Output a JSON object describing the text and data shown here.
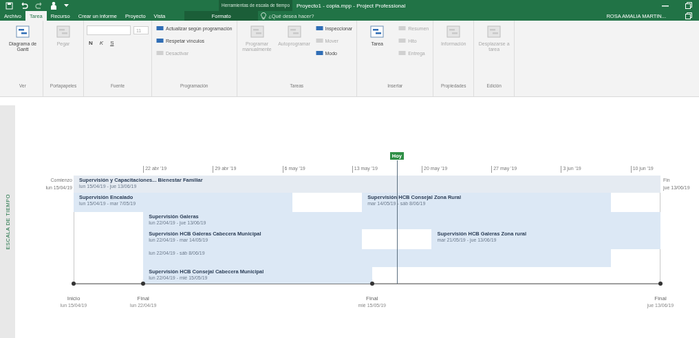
{
  "window": {
    "contextual_title": "Herramientas de escala de tiempo",
    "title": "Proyecto1 - copia.mpp - Project Professional"
  },
  "tabs": [
    {
      "label": "Archivo",
      "selected": false
    },
    {
      "label": "Tarea",
      "selected": true
    },
    {
      "label": "Recurso",
      "selected": false
    },
    {
      "label": "Crear un informe",
      "selected": false
    },
    {
      "label": "Proyecto",
      "selected": false
    },
    {
      "label": "Vista",
      "selected": false
    }
  ],
  "contextual_tab": {
    "label": "Formato",
    "selected": false
  },
  "search": {
    "placeholder": "¿Qué desea hacer?"
  },
  "user": "ROSA AMALIA MARTIN...",
  "ribbon": [
    {
      "label": "Ver",
      "items": [
        {
          "kind": "large",
          "label": "Diagrama de Gantt",
          "disabled": false
        }
      ]
    },
    {
      "label": "Portapapeles",
      "items": [
        {
          "kind": "large",
          "label": "Pegar",
          "disabled": true
        }
      ]
    },
    {
      "label": "Fuente",
      "items": [
        {
          "kind": "font",
          "size": "11",
          "styles": [
            "N",
            "K",
            "S"
          ],
          "disabled": true
        }
      ]
    },
    {
      "label": "Programación",
      "items": [
        {
          "kind": "small",
          "label": "Actualizar según programación",
          "disabled": false
        },
        {
          "kind": "small",
          "label": "Respetar vínculos",
          "disabled": false
        },
        {
          "kind": "small",
          "label": "Desactivar",
          "disabled": true
        }
      ]
    },
    {
      "label": "Tareas",
      "items": [
        {
          "kind": "large",
          "label": "Programar manualmente",
          "disabled": true
        },
        {
          "kind": "large",
          "label": "Autoprogramar",
          "disabled": true
        },
        {
          "kind": "small",
          "label": "Inspeccionar",
          "disabled": false
        },
        {
          "kind": "small",
          "label": "Mover",
          "disabled": true
        },
        {
          "kind": "small",
          "label": "Modo",
          "disabled": false
        }
      ]
    },
    {
      "label": "Insertar",
      "items": [
        {
          "kind": "large",
          "label": "Tarea",
          "disabled": false
        },
        {
          "kind": "small",
          "label": "Resumen",
          "disabled": true
        },
        {
          "kind": "small",
          "label": "Hito",
          "disabled": true
        },
        {
          "kind": "small",
          "label": "Entrega",
          "disabled": true
        }
      ]
    },
    {
      "label": "Propiedades",
      "items": [
        {
          "kind": "large",
          "label": "Información",
          "disabled": true
        }
      ]
    },
    {
      "label": "Edición",
      "items": [
        {
          "kind": "large",
          "label": "Desplazarse a tarea",
          "disabled": true
        }
      ]
    }
  ],
  "timeline": {
    "side_label": "ESCALA DE TIEMPO",
    "scale": [
      "22 abr '19",
      "29 abr '19",
      "6 may '19",
      "13 may '19",
      "20 may '19",
      "27 may '19",
      "3 jun '19",
      "10 jun '19"
    ],
    "today": "Hoy",
    "start": {
      "label": "Comienzo",
      "date": "lun 15/04/19"
    },
    "finish": {
      "label": "Fin",
      "date": "jue 13/06/19"
    },
    "bars": [
      {
        "name": "Supervisión y Capacitaciones... Bienestar Familiar",
        "dates": "lun 15/04/19 - jue 13/06/19"
      },
      {
        "name": "Supervisión Encalado",
        "dates": "lun 15/04/19 - mar 7/05/19"
      },
      {
        "name": "Supervisión HCB Consejal Zona Rural",
        "dates": "mar 14/05/19 - sáb 8/06/19"
      },
      {
        "name": "Supervisión Galeras",
        "dates": "lun 22/04/19 - jue 13/06/19"
      },
      {
        "name": "Supervisión HCB Galeras Cabecera Municipal",
        "dates": "lun 22/04/19 - mar 14/05/19"
      },
      {
        "name": "Supervisión HCB Galeras Zona rural",
        "dates": "mar 21/05/19 - jue 13/06/19"
      },
      {
        "dates": "lun 22/04/19 - sáb 8/06/19"
      },
      {
        "name": "Supervisión HCB Consejal Cabecera Municipal",
        "dates": "lun 22/04/19 - mié 15/05/19"
      }
    ],
    "milestones": [
      {
        "label": "Inicio",
        "date": "lun 15/04/19"
      },
      {
        "label": "Final",
        "date": "lun 22/04/19"
      },
      {
        "label": "Final",
        "date": "mié 15/05/19"
      },
      {
        "label": "Final",
        "date": "jue 13/06/19"
      }
    ]
  }
}
